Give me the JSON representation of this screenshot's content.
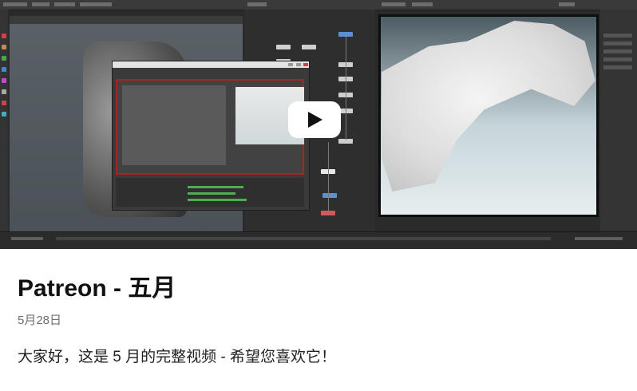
{
  "video": {
    "play_icon": "play-icon",
    "play_button_color": "#ffffff",
    "play_triangle_color": "#111111"
  },
  "post": {
    "title": "Patreon - 五月",
    "date": "5月28日",
    "body": "大家好，这是 5 月的完整视频 - 希望您喜欢它！"
  },
  "colors": {
    "title": "#111111",
    "date": "#6f6f6f",
    "body": "#222222",
    "embed_frame": "#a82424"
  }
}
